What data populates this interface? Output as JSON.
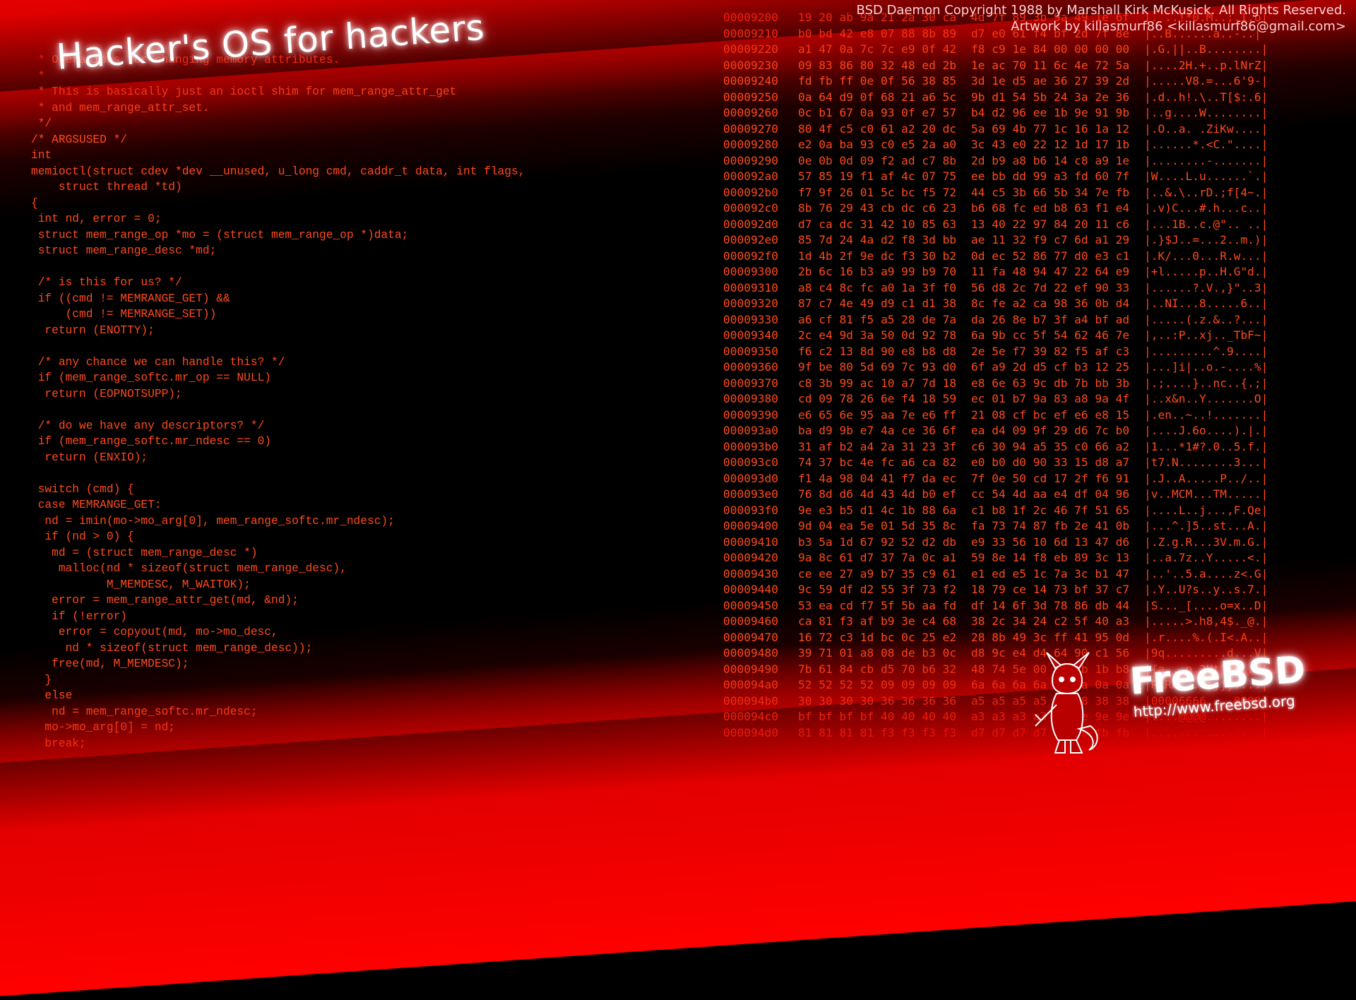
{
  "title": "Hacker's OS for hackers",
  "credits": {
    "line1": "BSD Daemon Copyright 1988 by Marshall Kirk McKusick. All Rights Reserved.",
    "line2": "Artwork by killasmurf86 <killasmurf86@gmail.com>"
  },
  "logo": {
    "name": "FreeBSD",
    "url": "http://www.freebsd.org",
    "icon": "bsd-daemon-icon"
  },
  "colors": {
    "accent": "#ff0000",
    "code_text": "#ff4a1c",
    "background": "#000000"
  },
  "code_lines": [
    " * Operations for changing memory attributes.",
    " *",
    " * This is basically just an ioctl shim for mem_range_attr_get",
    " * and mem_range_attr_set.",
    " */",
    "/* ARGSUSED */",
    "int",
    "memioctl(struct cdev *dev __unused, u_long cmd, caddr_t data, int flags,",
    "    struct thread *td)",
    "{",
    " int nd, error = 0;",
    " struct mem_range_op *mo = (struct mem_range_op *)data;",
    " struct mem_range_desc *md;",
    "",
    " /* is this for us? */",
    " if ((cmd != MEMRANGE_GET) &&",
    "     (cmd != MEMRANGE_SET))",
    "  return (ENOTTY);",
    "",
    " /* any chance we can handle this? */",
    " if (mem_range_softc.mr_op == NULL)",
    "  return (EOPNOTSUPP);",
    "",
    " /* do we have any descriptors? */",
    " if (mem_range_softc.mr_ndesc == 0)",
    "  return (ENXIO);",
    "",
    " switch (cmd) {",
    " case MEMRANGE_GET:",
    "  nd = imin(mo->mo_arg[0], mem_range_softc.mr_ndesc);",
    "  if (nd > 0) {",
    "   md = (struct mem_range_desc *)",
    "    malloc(nd * sizeof(struct mem_range_desc),",
    "           M_MEMDESC, M_WAITOK);",
    "   error = mem_range_attr_get(md, &nd);",
    "   if (!error)",
    "    error = copyout(md, mo->mo_desc,",
    "     nd * sizeof(struct mem_range_desc));",
    "   free(md, M_MEMDESC);",
    "  }",
    "  else",
    "   nd = mem_range_softc.mr_ndesc;",
    "  mo->mo_arg[0] = nd;",
    "  break;"
  ],
  "hex_rows": [
    [
      "00009200",
      "19 20 ab 9a 21 2a 30 ca",
      "4d 7f 89 3b 9a 49 1e 6f",
      "|. ..!*0.M..;.I.o|"
    ],
    [
      "00009210",
      "b0 bd 42 e8 07 88 8b 89",
      "d7 e0 61 f4 bf 2d 7f 8e",
      "|..B......a..-..|"
    ],
    [
      "00009220",
      "a1 47 0a 7c 7c e9 0f 42",
      "f8 c9 1e 84 00 00 00 00",
      "|.G.||..B........|"
    ],
    [
      "00009230",
      "09 83 86 80 32 48 ed 2b",
      "1e ac 70 11 6c 4e 72 5a",
      "|....2H.+..p.lNrZ|"
    ],
    [
      "00009240",
      "fd fb ff 0e 0f 56 38 85",
      "3d 1e d5 ae 36 27 39 2d",
      "|.....V8.=...6'9-|"
    ],
    [
      "00009250",
      "0a 64 d9 0f 68 21 a6 5c",
      "9b d1 54 5b 24 3a 2e 36",
      "|.d..h!.\\..T[$:.6|"
    ],
    [
      "00009260",
      "0c b1 67 0a 93 0f e7 57",
      "b4 d2 96 ee 1b 9e 91 9b",
      "|..g....W........|"
    ],
    [
      "00009270",
      "80 4f c5 c0 61 a2 20 dc",
      "5a 69 4b 77 1c 16 1a 12",
      "|.O..a. .ZiKw....|"
    ],
    [
      "00009280",
      "e2 0a ba 93 c0 e5 2a a0",
      "3c 43 e0 22 12 1d 17 1b",
      "|......*.<C.\"....|"
    ],
    [
      "00009290",
      "0e 0b 0d 09 f2 ad c7 8b",
      "2d b9 a8 b6 14 c8 a9 1e",
      "|........-.......|"
    ],
    [
      "000092a0",
      "57 85 19 f1 af 4c 07 75",
      "ee bb dd 99 a3 fd 60 7f",
      "|W....L.u......`.|"
    ],
    [
      "000092b0",
      "f7 9f 26 01 5c bc f5 72",
      "44 c5 3b 66 5b 34 7e fb",
      "|..&.\\..rD.;f[4~.|"
    ],
    [
      "000092c0",
      "8b 76 29 43 cb dc c6 23",
      "b6 68 fc ed b8 63 f1 e4",
      "|.v)C...#.h...c..|"
    ],
    [
      "000092d0",
      "d7 ca dc 31 42 10 85 63",
      "13 40 22 97 84 20 11 c6",
      "|...1B..c.@\".. ..|"
    ],
    [
      "000092e0",
      "85 7d 24 4a d2 f8 3d bb",
      "ae 11 32 f9 c7 6d a1 29",
      "|.}$J..=...2..m.)|"
    ],
    [
      "000092f0",
      "1d 4b 2f 9e dc f3 30 b2",
      "0d ec 52 86 77 d0 e3 c1",
      "|.K/...0...R.w...|"
    ],
    [
      "00009300",
      "2b 6c 16 b3 a9 99 b9 70",
      "11 fa 48 94 47 22 64 e9",
      "|+l.....p..H.G\"d.|"
    ],
    [
      "00009310",
      "a8 c4 8c fc a0 1a 3f f0",
      "56 d8 2c 7d 22 ef 90 33",
      "|......?.V.,}\"..3|"
    ],
    [
      "00009320",
      "87 c7 4e 49 d9 c1 d1 38",
      "8c fe a2 ca 98 36 0b d4",
      "|..NI...8.....6..|"
    ],
    [
      "00009330",
      "a6 cf 81 f5 a5 28 de 7a",
      "da 26 8e b7 3f a4 bf ad",
      "|.....(.z.&..?...|"
    ],
    [
      "00009340",
      "2c e4 9d 3a 50 0d 92 78",
      "6a 9b cc 5f 54 62 46 7e",
      "|,..:P..xj.._TbF~|"
    ],
    [
      "00009350",
      "f6 c2 13 8d 90 e8 b8 d8",
      "2e 5e f7 39 82 f5 af c3",
      "|.........^.9....|"
    ],
    [
      "00009360",
      "9f be 80 5d 69 7c 93 d0",
      "6f a9 2d d5 cf b3 12 25",
      "|...]i|..o.-....%|"
    ],
    [
      "00009370",
      "c8 3b 99 ac 10 a7 7d 18",
      "e8 6e 63 9c db 7b bb 3b",
      "|.;....}..nc..{.;|"
    ],
    [
      "00009380",
      "cd 09 78 26 6e f4 18 59",
      "ec 01 b7 9a 83 a8 9a 4f",
      "|..x&n..Y.......O|"
    ],
    [
      "00009390",
      "e6 65 6e 95 aa 7e e6 ff",
      "21 08 cf bc ef e6 e8 15",
      "|.en..~..!.......|"
    ],
    [
      "000093a0",
      "ba d9 9b e7 4a ce 36 6f",
      "ea d4 09 9f 29 d6 7c b0",
      "|....J.6o....).|.|"
    ],
    [
      "000093b0",
      "31 af b2 a4 2a 31 23 3f",
      "c6 30 94 a5 35 c0 66 a2",
      "|1...*1#?.0..5.f.|"
    ],
    [
      "000093c0",
      "74 37 bc 4e fc a6 ca 82",
      "e0 b0 d0 90 33 15 d8 a7",
      "|t7.N........3...|"
    ],
    [
      "000093d0",
      "f1 4a 98 04 41 f7 da ec",
      "7f 0e 50 cd 17 2f f6 91",
      "|.J..A.....P../..|"
    ],
    [
      "000093e0",
      "76 8d d6 4d 43 4d b0 ef",
      "cc 54 4d aa e4 df 04 96",
      "|v..MCM...TM.....|"
    ],
    [
      "000093f0",
      "9e e3 b5 d1 4c 1b 88 6a",
      "c1 b8 1f 2c 46 7f 51 65",
      "|....L..j...,F.Qe|"
    ],
    [
      "00009400",
      "9d 04 ea 5e 01 5d 35 8c",
      "fa 73 74 87 fb 2e 41 0b",
      "|...^.]5..st...A.|"
    ],
    [
      "00009410",
      "b3 5a 1d 67 92 52 d2 db",
      "e9 33 56 10 6d 13 47 d6",
      "|.Z.g.R...3V.m.G.|"
    ],
    [
      "00009420",
      "9a 8c 61 d7 37 7a 0c a1",
      "59 8e 14 f8 eb 89 3c 13",
      "|..a.7z..Y.....<.|"
    ],
    [
      "00009430",
      "ce ee 27 a9 b7 35 c9 61",
      "e1 ed e5 1c 7a 3c b1 47",
      "|..'..5.a....z<.G|"
    ],
    [
      "00009440",
      "9c 59 df d2 55 3f 73 f2",
      "18 79 ce 14 73 bf 37 c7",
      "|.Y..U?s..y..s.7.|"
    ],
    [
      "00009450",
      "53 ea cd f7 5f 5b aa fd",
      "df 14 6f 3d 78 86 db 44",
      "|S..._[....o=x..D|"
    ],
    [
      "00009460",
      "ca 81 f3 af b9 3e c4 68",
      "38 2c 34 24 c2 5f 40 a3",
      "|.....>.h8,4$._@.|"
    ],
    [
      "00009470",
      "16 72 c3 1d bc 0c 25 e2",
      "28 8b 49 3c ff 41 95 0d",
      "|.r....%.(.I<.A..|"
    ],
    [
      "00009480",
      "39 71 01 a8 08 de b3 0c",
      "d8 9c e4 d4 64 90 c1 56",
      "|9q.........d...V|"
    ],
    [
      "00009490",
      "7b 61 84 cb d5 70 b6 32",
      "48 74 5e 00 42 1b 1b b8",
      "|{a...p.2Ht^.B...|"
    ],
    [
      "000094a0",
      "52 52 52 52 09 09 09 09",
      "6a 6a 6a 6a 0a 0a 0a 0a",
      "|RRRR....jjjj....|"
    ],
    [
      "000094b0",
      "30 30 30 30 36 36 36 36",
      "a5 a5 a5 a5 38 38 38 38",
      "|00006666....8888|"
    ],
    [
      "000094c0",
      "bf bf bf bf 40 40 40 40",
      "a3 a3 a3 a3 9e 9e 9e 9e",
      "|....@@@@........|"
    ],
    [
      "000094d0",
      "81 81 81 81 f3 f3 f3 f3",
      "d7 d7 d7 d7 fb fb fb fb",
      "|................|"
    ]
  ]
}
